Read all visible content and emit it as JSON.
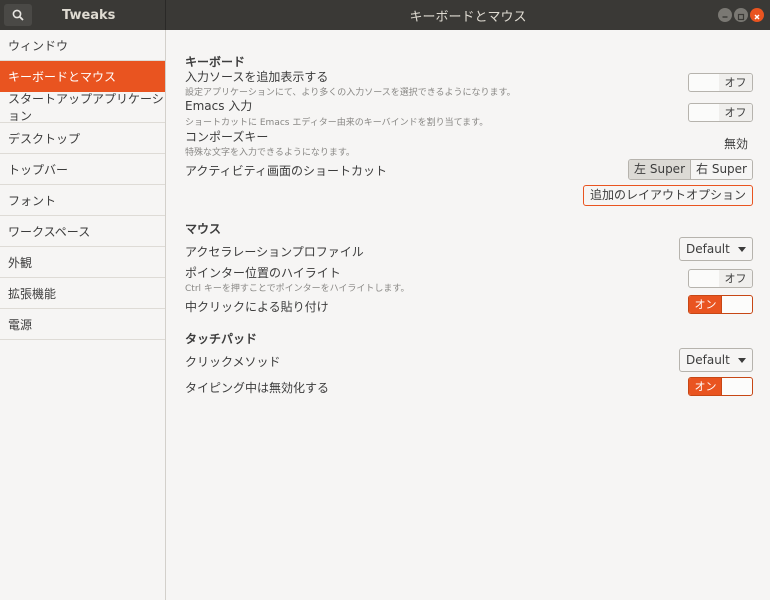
{
  "header": {
    "app_title": "Tweaks",
    "window_title": "キーボードとマウス"
  },
  "sidebar": {
    "items": [
      {
        "label": "ウィンドウ"
      },
      {
        "label": "キーボードとマウス",
        "active": true
      },
      {
        "label": "スタートアップアプリケーション"
      },
      {
        "label": "デスクトップ"
      },
      {
        "label": "トップバー"
      },
      {
        "label": "フォント"
      },
      {
        "label": "ワークスペース"
      },
      {
        "label": "外観"
      },
      {
        "label": "拡張機能"
      },
      {
        "label": "電源"
      }
    ]
  },
  "keyboard": {
    "heading": "キーボード",
    "input_sources": {
      "label": "入力ソースを追加表示する",
      "desc": "設定アプリケーションにて、より多くの入力ソースを選択できるようになります。",
      "state": "オフ"
    },
    "emacs": {
      "label": "Emacs 入力",
      "desc": "ショートカットに Emacs エディター由来のキーバインドを割り当てます。",
      "state": "オフ"
    },
    "compose": {
      "label": "コンポーズキー",
      "desc": "特殊な文字を入力できるようになります。",
      "value": "無効"
    },
    "overview": {
      "label": "アクティビティ画面のショートカット",
      "option_left": "左 Super",
      "option_right": "右 Super",
      "selected": "左 Super"
    },
    "additional_layout_button": "追加のレイアウトオプション"
  },
  "mouse": {
    "heading": "マウス",
    "accel": {
      "label": "アクセラレーションプロファイル",
      "value": "Default"
    },
    "pointer_highlight": {
      "label": "ポインター位置のハイライト",
      "desc": "Ctrl キーを押すことでポインターをハイライトします。",
      "state": "オフ"
    },
    "middle_paste": {
      "label": "中クリックによる貼り付け",
      "state": "オン"
    }
  },
  "touchpad": {
    "heading": "タッチパッド",
    "click_method": {
      "label": "クリックメソッド",
      "value": "Default"
    },
    "disable_typing": {
      "label": "タイピング中は無効化する",
      "state": "オン"
    }
  },
  "colors": {
    "accent": "#e95420",
    "titlebar": "#3a3936",
    "background": "#f6f5f4"
  }
}
